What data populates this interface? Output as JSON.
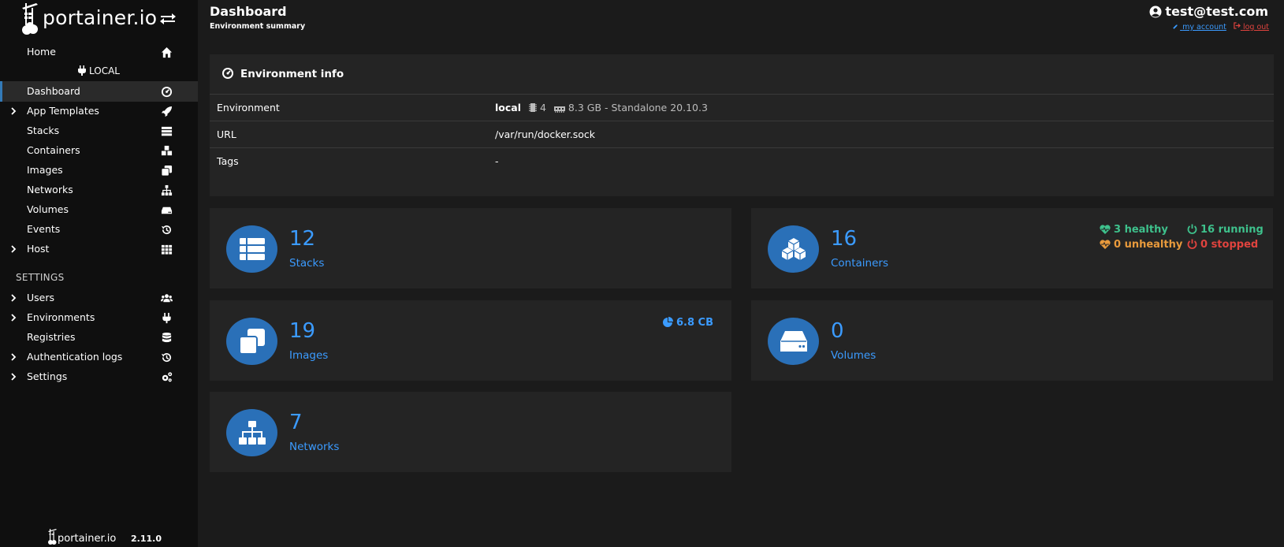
{
  "sidebar": {
    "brand": "portainer.io",
    "environment": "LOCAL",
    "settings_title": "SETTINGS",
    "items": [
      {
        "label": "Home",
        "icon": "home-icon"
      },
      {
        "label": "Dashboard",
        "icon": "dashboard-icon"
      },
      {
        "label": "App Templates",
        "icon": "rocket-icon"
      },
      {
        "label": "Stacks",
        "icon": "list-icon"
      },
      {
        "label": "Containers",
        "icon": "cubes-icon"
      },
      {
        "label": "Images",
        "icon": "clone-icon"
      },
      {
        "label": "Networks",
        "icon": "sitemap-icon"
      },
      {
        "label": "Volumes",
        "icon": "hdd-icon"
      },
      {
        "label": "Events",
        "icon": "history-icon"
      },
      {
        "label": "Host",
        "icon": "th-icon"
      },
      {
        "label": "Users",
        "icon": "users-icon"
      },
      {
        "label": "Environments",
        "icon": "plug-icon"
      },
      {
        "label": "Registries",
        "icon": "database-icon"
      },
      {
        "label": "Authentication logs",
        "icon": "history-icon"
      },
      {
        "label": "Settings",
        "icon": "cogs-icon"
      }
    ],
    "footer_brand": "portainer.io",
    "version": "2.11.0"
  },
  "header": {
    "title": "Dashboard",
    "subtitle": "Environment summary",
    "user": "test@test.com",
    "my_account": "my account",
    "log_out": "log out"
  },
  "env_info": {
    "title": "Environment info",
    "rows": [
      {
        "key": "Environment",
        "name": "local",
        "cpu": "4",
        "memory": "8.3 GB - Standalone 20.10.3"
      },
      {
        "key": "URL",
        "value": "/var/run/docker.sock"
      },
      {
        "key": "Tags",
        "value": "-"
      }
    ]
  },
  "cards": {
    "stacks": {
      "count": "12",
      "label": "Stacks"
    },
    "containers": {
      "count": "16",
      "label": "Containers",
      "healthy": "3 healthy",
      "unhealthy": "0 unhealthy",
      "running": "16 running",
      "stopped": "0 stopped"
    },
    "images": {
      "count": "19",
      "label": "Images",
      "size": "6.8 CB"
    },
    "volumes": {
      "count": "0",
      "label": "Volumes"
    },
    "networks": {
      "count": "7",
      "label": "Networks"
    }
  },
  "colors": {
    "accent": "#3b9bff",
    "circle": "#2a70b8",
    "healthy": "#3ec18c",
    "unhealthy": "#e89a3c",
    "running": "#3ec18c",
    "stopped": "#e0433e"
  }
}
